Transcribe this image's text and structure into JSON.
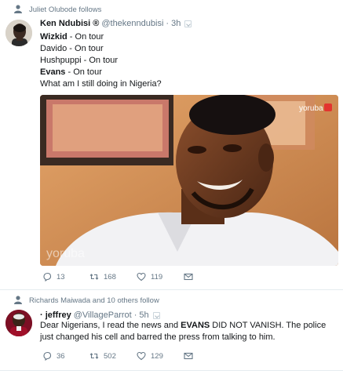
{
  "tweets": [
    {
      "context_text": "Juliet Olubode follows",
      "name": "Ken Ndubisi ®",
      "handle": "@thekenndubisi",
      "dot": "·",
      "time": "3h",
      "lines": [
        {
          "bold": "Wizkid",
          "rest": " - On tour"
        },
        {
          "bold": "Davido",
          "rest": " - On tour"
        },
        {
          "bold": "",
          "rest": "Hushpuppi - On tour"
        },
        {
          "bold": "Evans",
          "rest": " - On tour"
        },
        {
          "bold": "",
          "rest": "What am I still doing in Nigeria?"
        }
      ],
      "media_watermark_top": "yoruba",
      "media_watermark_bottom": "yoruba",
      "replies": "13",
      "retweets": "168",
      "likes": "119"
    },
    {
      "context_text": "Richards Maiwada and 10 others follow",
      "name": "· jeffrey",
      "handle": "@VillageParrot",
      "dot": "·",
      "time": "5h",
      "text_before": "Dear Nigerians, I read the news and ",
      "text_bold": "EVANS",
      "text_after": " DID NOT VANISH. The police just changed his cell and barred the press from talking to him.",
      "replies": "36",
      "retweets": "502",
      "likes": "129"
    }
  ],
  "colors": {
    "secondary_text": "#657786",
    "divider": "#e6ecf0",
    "primary_text": "#14171a"
  },
  "icons": [
    "person-icon",
    "reply-icon",
    "retweet-icon",
    "like-icon",
    "message-icon",
    "caret-down-icon"
  ]
}
